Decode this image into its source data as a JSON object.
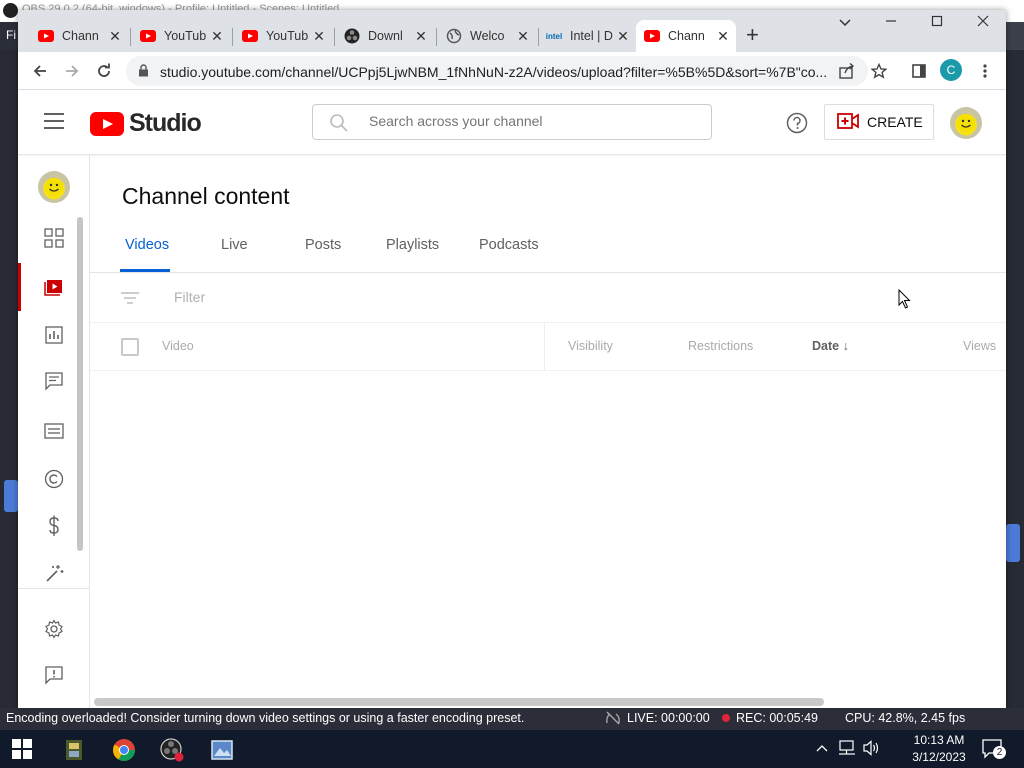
{
  "obs": {
    "title": "OBS 29.0.2 (64-bit, windows) - Profile: Untitled - Scenes: Untitled",
    "menu_letter": "Fi",
    "status_message": "Encoding overloaded! Consider turning down video settings or using a faster encoding preset.",
    "live": "LIVE: 00:00:00",
    "rec": "REC: 00:05:49",
    "cpu": "CPU: 42.8%, 2.45 fps"
  },
  "chrome": {
    "tabs": [
      {
        "title": "Channel content - YouTube Studio",
        "short": "Chann",
        "icon": "youtube-icon"
      },
      {
        "title": "YouTube",
        "short": "YouTub",
        "icon": "youtube-icon"
      },
      {
        "title": "YouTube",
        "short": "YouTub",
        "icon": "youtube-icon"
      },
      {
        "title": "Download",
        "short": "Downl",
        "icon": "obs-icon"
      },
      {
        "title": "Welcome",
        "short": "Welco",
        "icon": "globe-icon"
      },
      {
        "title": "Intel | Data Center Solutions",
        "short": "Intel | D",
        "icon": "intel-icon"
      },
      {
        "title": "Channel content - YouTube Studio",
        "short": "Chann",
        "icon": "youtube-icon"
      }
    ],
    "url": "studio.youtube.com/channel/UCPpj5LjwNBM_1fNhNuN-z2A/videos/upload?filter=%5B%5D&sort=%7B\"co...",
    "profile_initial": "C"
  },
  "studio": {
    "logo_text": "Studio",
    "search_placeholder": "Search across your channel",
    "create_label": "CREATE",
    "page_title": "Channel content",
    "tabs": [
      "Videos",
      "Live",
      "Posts",
      "Playlists",
      "Podcasts"
    ],
    "active_tab": "Videos",
    "filter_placeholder": "Filter",
    "columns": {
      "video": "Video",
      "visibility": "Visibility",
      "restrictions": "Restrictions",
      "date": "Date",
      "views": "Views"
    },
    "sort_indicator": "↓"
  },
  "taskbar": {
    "time": "10:13 AM",
    "date": "3/12/2023",
    "notification_count": "2"
  }
}
